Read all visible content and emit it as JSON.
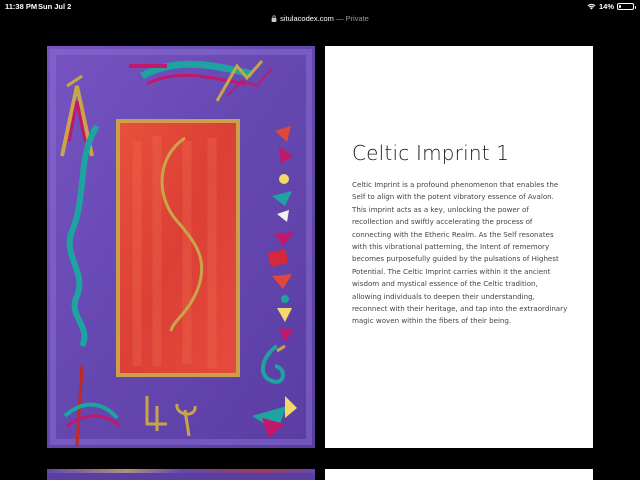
{
  "status_bar": {
    "time": "11:38 PM",
    "date": "Sun Jul 2",
    "battery_text": "14%",
    "battery_level": 0.14
  },
  "address_bar": {
    "domain": "situlacodex.com",
    "suffix": "— Private"
  },
  "artwork": {
    "icons": [
      "wifi-icon",
      "battery-icon",
      "lock-icon"
    ],
    "colors": {
      "purple": "#6a4bb0",
      "red": "#e0483a",
      "gold": "#c9a54a",
      "teal": "#1ea4a0",
      "magenta": "#c2186b"
    }
  },
  "article": {
    "title": "Celtic Imprint 1",
    "description": "Celtic Imprint is a profound phenomenon that enables the Self to align with the potent vibratory essence of Avalon. This imprint acts as a key, unlocking the power of recollection and swiftly accelerating the process of connecting with the Etheric Realm. As the Self resonates with this vibrational patterning, the Intent of rememory becomes purposefully guided by the pulsations of Highest Potential. The Celtic Imprint carries within it the ancient wisdom and mystical essence of the Celtic tradition, allowing individuals to deepen their understanding, reconnect with their heritage, and tap into the extraordinary magic woven within the fibers of their being."
  }
}
